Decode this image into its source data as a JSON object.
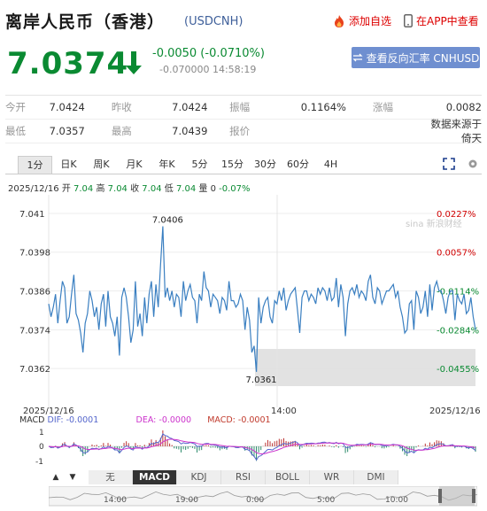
{
  "header": {
    "title": "离岸人民币（香港）",
    "code": "(USDCNH)",
    "add_watch": "添加自选",
    "app_view": "在APP中查看",
    "price": "7.0374",
    "change": "-0.0050 (-0.0710%)",
    "sub": "-0.070000 14:58:19",
    "reverse_btn": "查看反向汇率 CNHUSD",
    "colors": {
      "down": "#0a8a32",
      "up": "#d00000",
      "accent": "#6f8fd0"
    }
  },
  "stats": {
    "row1": [
      {
        "label": "今开",
        "value": "7.0424"
      },
      {
        "label": "昨收",
        "value": "7.0424"
      },
      {
        "label": "振幅",
        "value": "0.1164%"
      },
      {
        "label": "涨幅",
        "value": "0.0082"
      }
    ],
    "row2": [
      {
        "label": "最低",
        "value": "7.0357"
      },
      {
        "label": "最高",
        "value": "7.0439"
      },
      {
        "label": "报价",
        "value": ""
      },
      {
        "label": "",
        "value": "数据来源于倚天"
      }
    ]
  },
  "tabs": [
    "1分",
    "日K",
    "周K",
    "月K",
    "年K",
    "5分",
    "15分",
    "30分",
    "60分",
    "4H"
  ],
  "ticker": {
    "date": "2025/12/16",
    "open_lab": "开",
    "open": "7.04",
    "high_lab": "高",
    "high": "7.04",
    "close_lab": "收",
    "close": "7.04",
    "low_lab": "低",
    "low": "7.04",
    "vol_lab": "量",
    "vol": "0",
    "pct": "-0.07%"
  },
  "chart_data": {
    "type": "line",
    "title": "",
    "y_ticks": [
      "7.041",
      "7.0398",
      "7.0386",
      "7.0374",
      "7.0362"
    ],
    "pct_ticks": [
      "0.0227%",
      "0.0057%",
      "-0.0114%",
      "-0.0284%",
      "-0.0455%"
    ],
    "x_ticks": [
      "2025/12/16",
      "14:00",
      "2025/12/16"
    ],
    "ylim": [
      7.0356,
      7.0413
    ],
    "annotations": [
      {
        "label": "7.0406",
        "value": 7.0406
      },
      {
        "label": "7.0361",
        "value": 7.0361
      }
    ],
    "values": [
      7.0382,
      7.0378,
      7.0381,
      7.0385,
      7.0376,
      7.0383,
      7.0389,
      7.0387,
      7.0376,
      7.0378,
      7.0385,
      7.0391,
      7.0379,
      7.0377,
      7.0373,
      7.0367,
      7.0376,
      7.0379,
      7.0386,
      7.0383,
      7.0378,
      7.0381,
      7.0374,
      7.0382,
      7.0385,
      7.0375,
      7.0386,
      7.0378,
      7.0376,
      7.0372,
      7.0378,
      7.0366,
      7.0384,
      7.0387,
      7.0384,
      7.0378,
      7.037,
      7.0374,
      7.0389,
      7.0375,
      7.0379,
      7.0372,
      7.0384,
      7.0376,
      7.0385,
      7.0389,
      7.0378,
      7.0388,
      7.0381,
      7.0394,
      7.0406,
      7.0384,
      7.0387,
      7.0383,
      7.0386,
      7.0381,
      7.0385,
      7.0384,
      7.0378,
      7.0389,
      7.0383,
      7.0386,
      7.0388,
      7.0384,
      7.0383,
      7.0376,
      7.0385,
      7.0383,
      7.0392,
      7.0387,
      7.0386,
      7.0381,
      7.0385,
      7.0384,
      7.0383,
      7.0379,
      7.0384,
      7.0383,
      7.038,
      7.0389,
      7.0383,
      7.0383,
      7.0381,
      7.0382,
      7.0385,
      7.0383,
      7.0374,
      7.0381,
      7.0377,
      7.0367,
      7.0369,
      7.0361,
      7.0384,
      7.0376,
      7.0381,
      7.0383,
      7.0384,
      7.0378,
      7.0376,
      7.0383,
      7.0382,
      7.0386,
      7.0383,
      7.0387,
      7.038,
      7.0383,
      7.0385,
      7.0386,
      7.0387,
      7.038,
      7.0373,
      7.0384,
      7.0386,
      7.0386,
      7.0383,
      7.0385,
      7.0384,
      7.0382,
      7.0387,
      7.0385,
      7.0387,
      7.0386,
      7.0383,
      7.0387,
      7.0383,
      7.0384,
      7.039,
      7.0381,
      7.0388,
      7.0384,
      7.0372,
      7.0382,
      7.0386,
      7.0387,
      7.0385,
      7.0388,
      7.0384,
      7.0386,
      7.0385,
      7.0383,
      7.0389,
      7.0391,
      7.0384,
      7.0382,
      7.0387,
      7.0386,
      7.0382,
      7.0384,
      7.0386,
      7.0386,
      7.0387,
      7.0388,
      7.0384,
      7.0386,
      7.0381,
      7.0378,
      7.0373,
      7.0374,
      7.0382,
      7.0383,
      7.0374,
      7.0386,
      7.0384,
      7.0379,
      7.0381,
      7.0386,
      7.0378,
      7.0388,
      7.038,
      7.0387,
      7.0389,
      7.0386,
      7.0386,
      7.0383,
      7.0379,
      7.0384,
      7.0386,
      7.0386,
      7.0377,
      7.0385,
      7.0383,
      7.0382,
      7.0385,
      7.0379,
      7.038,
      7.0384,
      7.0378,
      7.0374
    ]
  },
  "macd": {
    "label": "MACD",
    "dif": "DIF: -0.0001",
    "dea": "DEA: -0.0000",
    "macd": "MACD: -0.0001",
    "ticks": [
      "1",
      "0",
      "-1"
    ],
    "colors": {
      "dif": "#5566cc",
      "dea": "#cc33cc",
      "pos": "#b33",
      "neg": "#2a8a6a"
    }
  },
  "indicators": [
    "无",
    "MACD",
    "KDJ",
    "RSI",
    "BOLL",
    "WR",
    "DMI"
  ],
  "timeline": {
    "labels": [
      "14:00",
      "19:00",
      "0:00",
      "5:00",
      "10:00"
    ]
  },
  "watermark": "sina 新浪财经"
}
